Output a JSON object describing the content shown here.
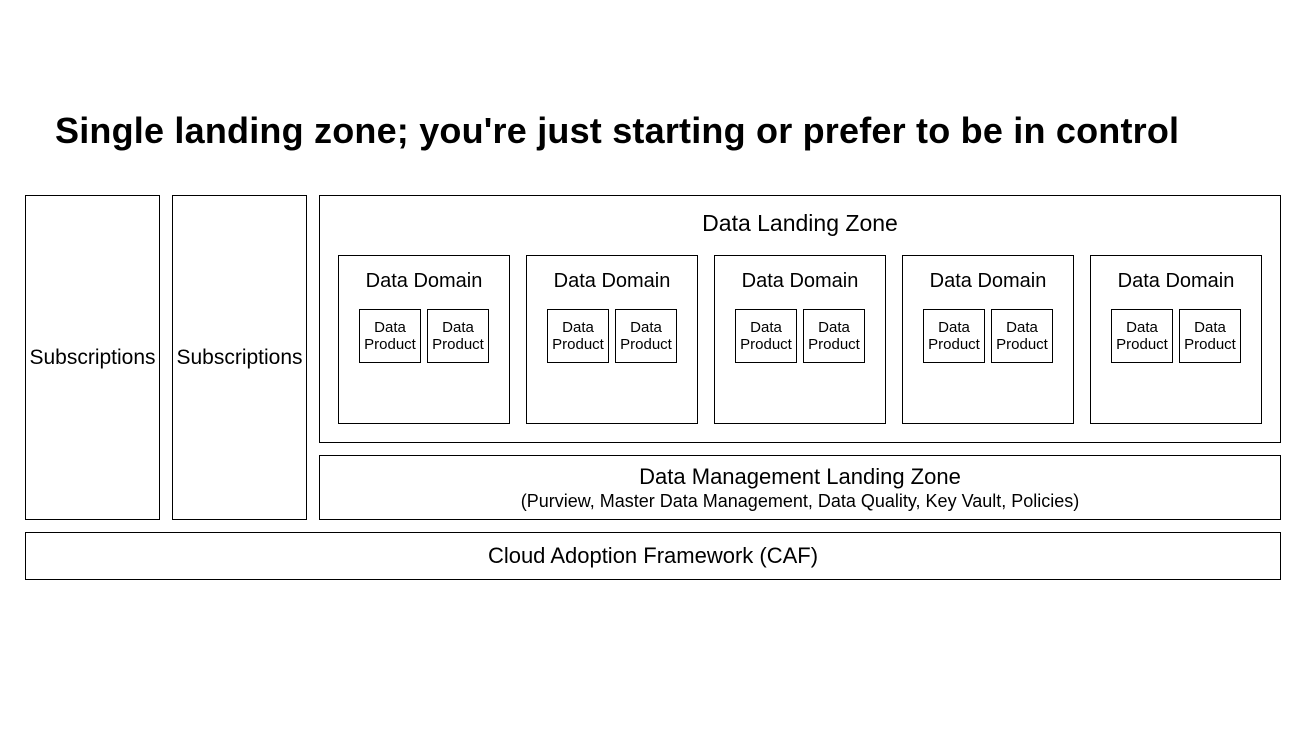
{
  "title": "Single landing zone; you're just starting or prefer to be in control",
  "subscriptions": [
    "Subscriptions",
    "Subscriptions"
  ],
  "dlz": {
    "title": "Data Landing Zone",
    "domains": [
      {
        "title": "Data Domain",
        "products": [
          "Data Product",
          "Data Product"
        ]
      },
      {
        "title": "Data Domain",
        "products": [
          "Data Product",
          "Data Product"
        ]
      },
      {
        "title": "Data Domain",
        "products": [
          "Data Product",
          "Data Product"
        ]
      },
      {
        "title": "Data Domain",
        "products": [
          "Data Product",
          "Data Product"
        ]
      },
      {
        "title": "Data Domain",
        "products": [
          "Data Product",
          "Data Product"
        ]
      }
    ]
  },
  "dmlz": {
    "title": "Data Management Landing Zone",
    "subtitle": "(Purview, Master Data Management, Data Quality, Key Vault, Policies)"
  },
  "caf": "Cloud Adoption Framework (CAF)"
}
